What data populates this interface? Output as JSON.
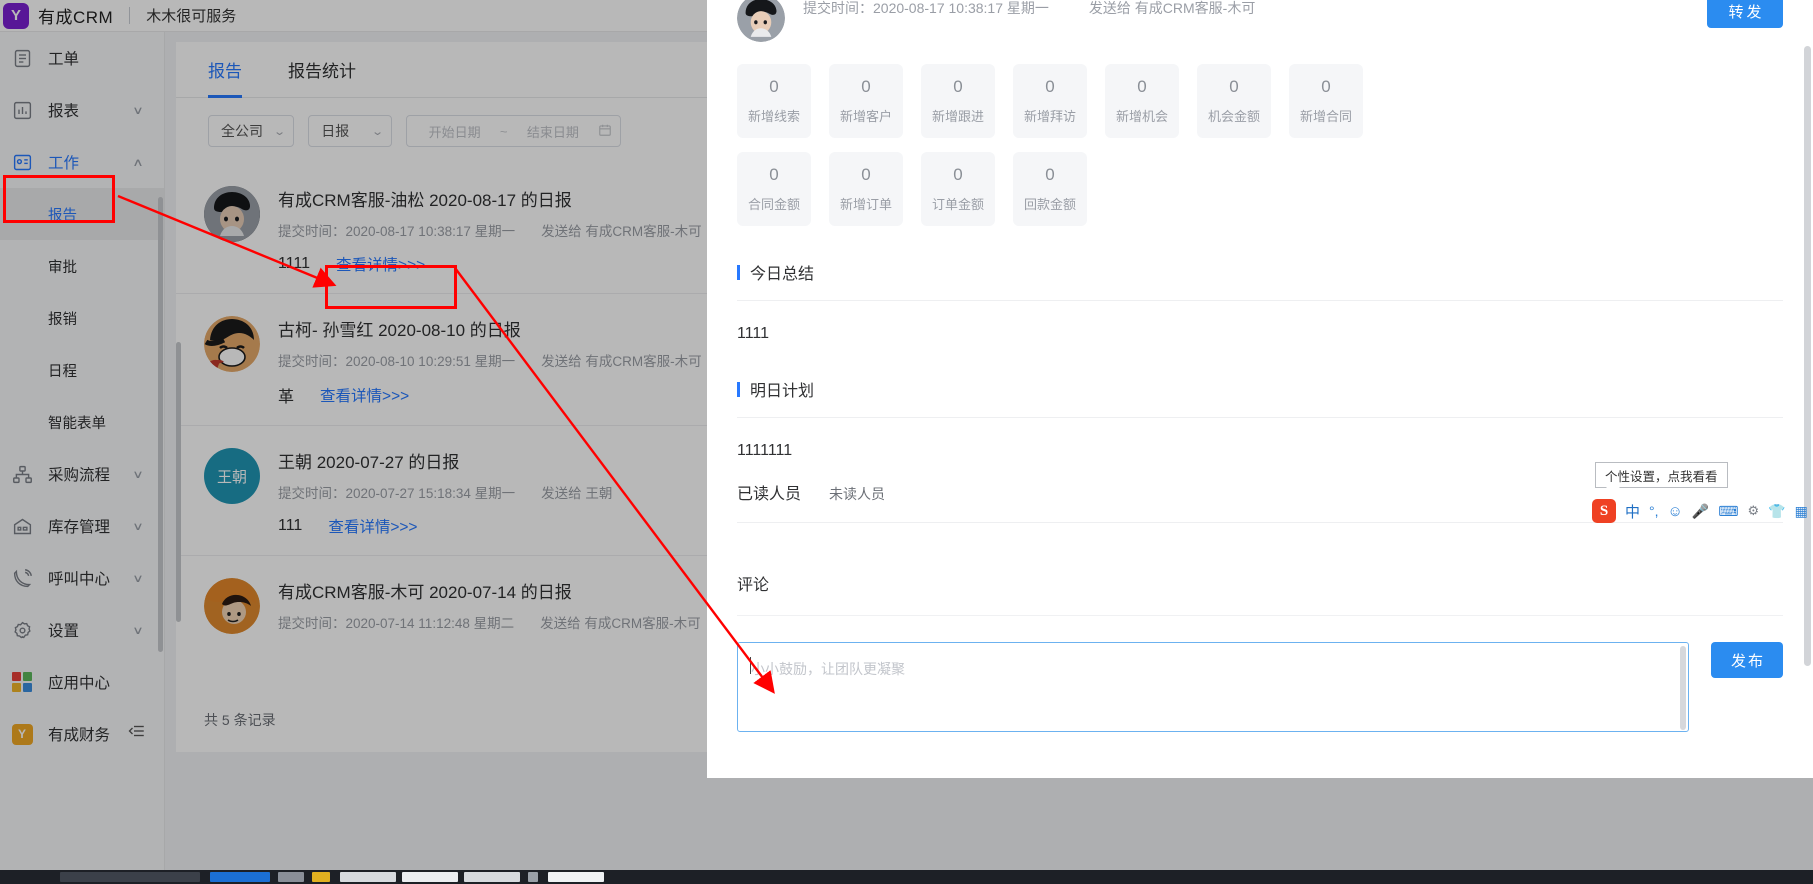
{
  "header": {
    "logo_letter": "Y",
    "brand": "有成CRM",
    "tenant": "木木很可服务"
  },
  "sidebar": {
    "items": [
      {
        "label": "工单",
        "icon": "clipboard-icon",
        "chevron": "",
        "active": false
      },
      {
        "label": "报表",
        "icon": "chart-icon",
        "chevron": "∨",
        "active": false
      },
      {
        "label": "工作",
        "icon": "id-card-icon",
        "chevron": "∧",
        "active": true
      }
    ],
    "sub_items": [
      {
        "label": "报告",
        "selected": true
      },
      {
        "label": "审批",
        "selected": false
      },
      {
        "label": "报销",
        "selected": false
      },
      {
        "label": "日程",
        "selected": false
      },
      {
        "label": "智能表单",
        "selected": false
      }
    ],
    "items2": [
      {
        "label": "采购流程",
        "icon": "sitemap-icon",
        "chevron": "∨"
      },
      {
        "label": "库存管理",
        "icon": "warehouse-icon",
        "chevron": "∨"
      },
      {
        "label": "呼叫中心",
        "icon": "phone-icon",
        "chevron": "∨"
      },
      {
        "label": "设置",
        "icon": "gear-icon",
        "chevron": "∨"
      }
    ],
    "items3": [
      {
        "label": "应用中心",
        "icon": "app-grid-icon"
      },
      {
        "label": "有成财务",
        "icon": "yc-finance-icon"
      }
    ],
    "collapse_icon": "collapse-sidebar-icon"
  },
  "list": {
    "tabs": [
      {
        "label": "报告",
        "active": true
      },
      {
        "label": "报告统计",
        "active": false
      }
    ],
    "filters": {
      "scope": "全公司",
      "type": "日报",
      "date_start_placeholder": "开始日期",
      "date_sep": "~",
      "date_end_placeholder": "结束日期",
      "calendar_icon": "calendar-icon"
    },
    "reports": [
      {
        "avatar_kind": "photo-dark",
        "avatar_text": "",
        "title": "有成CRM客服-油松 2020-08-17 的日报",
        "submitted": "提交时间：2020-08-17 10:38:17 星期一",
        "sent_to": "发送给 有成CRM客服-木可",
        "snippet": "1111",
        "link": "查看详情>>>"
      },
      {
        "avatar_kind": "photo-luffy",
        "avatar_text": "",
        "title": "古柯- 孙雪红 2020-08-10 的日报",
        "submitted": "提交时间：2020-08-10 10:29:51 星期一",
        "sent_to": "发送给 有成CRM客服-木可",
        "snippet": "革",
        "link": "查看详情>>>"
      },
      {
        "avatar_kind": "initials",
        "avatar_text": "王朝",
        "title": "王朝 2020-07-27 的日报",
        "submitted": "提交时间：2020-07-27 15:18:34 星期一",
        "sent_to": "发送给 王朝",
        "snippet": "111",
        "link": "查看详情>>>"
      },
      {
        "avatar_kind": "photo-orange",
        "avatar_text": "",
        "title": "有成CRM客服-木可 2020-07-14 的日报",
        "submitted": "提交时间：2020-07-14 11:12:48 星期二",
        "sent_to": "发送给 有成CRM客服-木可",
        "snippet": "",
        "link": ""
      }
    ],
    "count_text": "共 5 条记录"
  },
  "modal": {
    "submitted": "提交时间：2020-08-17 10:38:17 星期一",
    "sent_to": "发送给 有成CRM客服-木可",
    "forward_label": "转发",
    "stats_row1": [
      {
        "value": "0",
        "label": "新增线索"
      },
      {
        "value": "0",
        "label": "新增客户"
      },
      {
        "value": "0",
        "label": "新增跟进"
      },
      {
        "value": "0",
        "label": "新增拜访"
      },
      {
        "value": "0",
        "label": "新增机会"
      },
      {
        "value": "0",
        "label": "机会金额"
      },
      {
        "value": "0",
        "label": "新增合同"
      }
    ],
    "stats_row2": [
      {
        "value": "0",
        "label": "合同金额"
      },
      {
        "value": "0",
        "label": "新增订单"
      },
      {
        "value": "0",
        "label": "订单金额"
      },
      {
        "value": "0",
        "label": "回款金额"
      }
    ],
    "summary_title": "今日总结",
    "summary_body": "1111",
    "plan_title": "明日计划",
    "plan_body": "1111111",
    "readers_read": "已读人员",
    "readers_unread": "未读人员",
    "comment_title": "评论",
    "comment_placeholder": "小小鼓励，让团队更凝聚",
    "comment_value": "",
    "publish_label": "发布"
  },
  "ime": {
    "tooltip": "个性设置，点我看看",
    "logo": "S",
    "items": [
      "中",
      "°,",
      "☺",
      "Ἲ4",
      "⌨",
      "⚙",
      "T",
      "▦"
    ]
  },
  "colors": {
    "accent": "#2879ff",
    "button_blue": "#2b8cf0",
    "annotation_red": "#ff0000",
    "brand_purple": "#7b1fd1"
  }
}
